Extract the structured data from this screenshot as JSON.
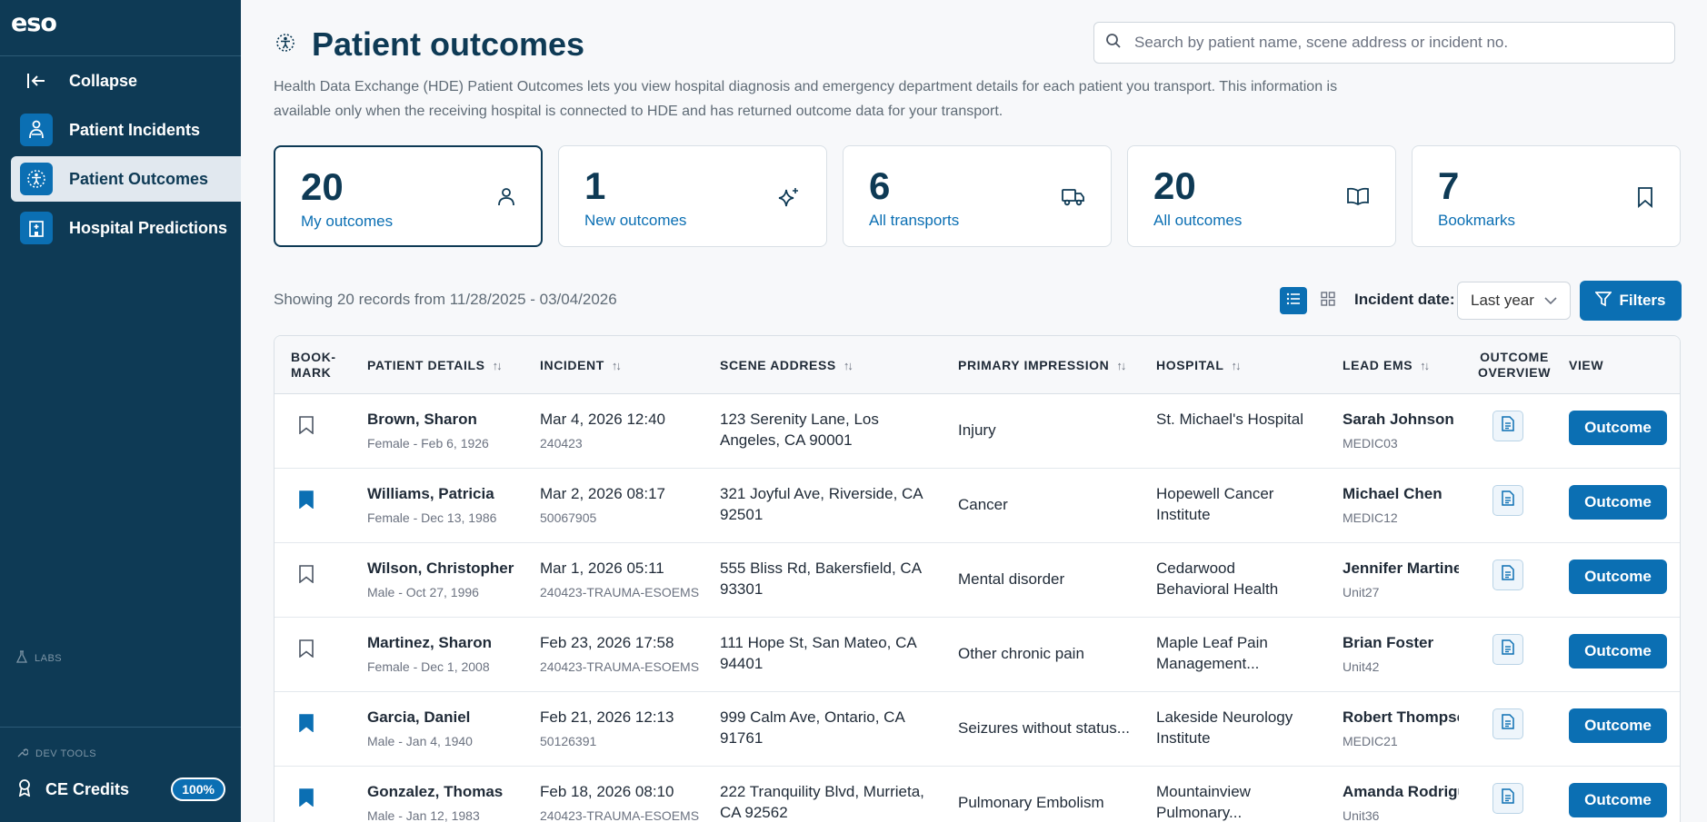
{
  "sidebar": {
    "logo": "eso",
    "collapse_label": "Collapse",
    "items": [
      {
        "label": "Patient Incidents",
        "icon": "patient-incidents-icon"
      },
      {
        "label": "Patient Outcomes",
        "icon": "patient-outcomes-icon",
        "active": true
      },
      {
        "label": "Hospital Predictions",
        "icon": "hospital-icon"
      }
    ],
    "labs_label": "LABS",
    "dev_tools_label": "DEV TOOLS",
    "ce_credits_label": "CE Credits",
    "ce_credits_pct": "100%"
  },
  "header": {
    "title": "Patient outcomes",
    "search_placeholder": "Search by patient name, scene address or incident no.",
    "description": "Health Data Exchange (HDE) Patient Outcomes lets you view hospital diagnosis and emergency department details for each patient you transport. This information is available only when the receiving hospital is connected to HDE and has returned outcome data for your transport."
  },
  "cards": [
    {
      "value": "20",
      "label": "My outcomes",
      "icon": "person-icon"
    },
    {
      "value": "1",
      "label": "New outcomes",
      "icon": "sparkle-icon"
    },
    {
      "value": "6",
      "label": "All transports",
      "icon": "truck-icon"
    },
    {
      "value": "20",
      "label": "All outcomes",
      "icon": "book-icon"
    },
    {
      "value": "7",
      "label": "Bookmarks",
      "icon": "bookmark-icon"
    }
  ],
  "toolbar": {
    "records_text": "Showing 20 records from 11/28/2025 - 03/04/2026",
    "incident_date_label": "Incident date:",
    "incident_date_value": "Last year",
    "filters_label": "Filters"
  },
  "table": {
    "headers": {
      "bookmark": [
        "BOOK-",
        "MARK"
      ],
      "patient": "PATIENT DETAILS",
      "incident": "INCIDENT",
      "scene": "SCENE ADDRESS",
      "impression": "PRIMARY IMPRESSION",
      "hospital": "HOSPITAL",
      "lead": "LEAD EMS",
      "overview": [
        "OUTCOME",
        "OVERVIEW"
      ],
      "view": "VIEW"
    },
    "outcome_button_label": "Outcome",
    "rows": [
      {
        "bookmarked": false,
        "name": "Brown, Sharon",
        "demo": "Female - Feb 6, 1926",
        "incident_date": "Mar 4, 2026 12:40",
        "incident_no": "240423",
        "scene1": "123 Serenity Lane, Los",
        "scene2": "Angeles, CA 90001",
        "impression": "Injury",
        "hospital1": "St. Michael's Hospital",
        "hospital2": "",
        "lead": "Sarah Johnson",
        "unit": "MEDIC03"
      },
      {
        "bookmarked": true,
        "name": "Williams, Patricia",
        "demo": "Female - Dec 13, 1986",
        "incident_date": "Mar 2, 2026 08:17",
        "incident_no": "50067905",
        "scene1": "321 Joyful Ave, Riverside, CA",
        "scene2": "92501",
        "impression": "Cancer",
        "hospital1": "Hopewell Cancer",
        "hospital2": "Institute",
        "lead": "Michael Chen",
        "unit": "MEDIC12"
      },
      {
        "bookmarked": false,
        "name": "Wilson, Christopher",
        "demo": "Male - Oct 27, 1996",
        "incident_date": "Mar 1, 2026 05:11",
        "incident_no": "240423-TRAUMA-ESOEMS",
        "scene1": "555 Bliss Rd, Bakersfield, CA",
        "scene2": "93301",
        "impression": "Mental disorder",
        "hospital1": "Cedarwood",
        "hospital2": "Behavioral Health",
        "lead": "Jennifer Martinez",
        "unit": "Unit27"
      },
      {
        "bookmarked": false,
        "name": "Martinez, Sharon",
        "demo": "Female - Dec 1, 2008",
        "incident_date": "Feb 23, 2026 17:58",
        "incident_no": "240423-TRAUMA-ESOEMS",
        "scene1": "111 Hope St, San Mateo, CA",
        "scene2": "94401",
        "impression": "Other chronic pain",
        "hospital1": "Maple Leaf Pain",
        "hospital2": "Management...",
        "lead": "Brian Foster",
        "unit": "Unit42"
      },
      {
        "bookmarked": true,
        "name": "Garcia, Daniel",
        "demo": "Male - Jan 4, 1940",
        "incident_date": "Feb 21, 2026 12:13",
        "incident_no": "50126391",
        "scene1": "999 Calm Ave, Ontario, CA",
        "scene2": "91761",
        "impression": "Seizures without status...",
        "hospital1": "Lakeside Neurology",
        "hospital2": "Institute",
        "lead": "Robert Thompson",
        "unit": "MEDIC21"
      },
      {
        "bookmarked": true,
        "name": "Gonzalez, Thomas",
        "demo": "Male - Jan 12, 1983",
        "incident_date": "Feb 18, 2026 08:10",
        "incident_no": "240423-TRAUMA-ESOEMS",
        "scene1": "222 Tranquility Blvd, Murrieta,",
        "scene2": "CA 92562",
        "impression": "Pulmonary Embolism",
        "hospital1": "Mountainview",
        "hospital2": "Pulmonary...",
        "lead": "Amanda Rodriguez",
        "unit": "Unit36"
      }
    ]
  },
  "colors": {
    "sidebar": "#0e3a55",
    "accent": "#0b6fb3"
  }
}
